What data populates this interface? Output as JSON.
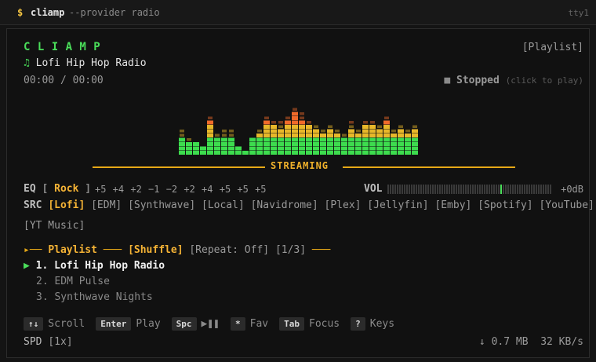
{
  "terminal": {
    "prompt": "$",
    "command": "cliamp",
    "args": "--provider radio",
    "tty": "tty1"
  },
  "player": {
    "logo": "C L I A M P",
    "playlist_toggle": "[Playlist]",
    "note_icon": "♫",
    "track_title": "Lofi Hip Hop Radio",
    "time": "00:00 / 00:00",
    "status_icon": "■",
    "status": "Stopped",
    "status_hint": "(click to play)"
  },
  "visualizer": {
    "label": "STREAMING",
    "colors": {
      "green": "#3ddc4e",
      "yellow": "#e8b82a",
      "orange": "#f06a2a"
    },
    "bands": [
      4,
      3,
      3,
      2,
      8,
      4,
      4,
      4,
      2,
      1,
      4,
      5,
      8,
      7,
      6,
      8,
      10,
      8,
      7,
      6,
      5,
      6,
      5,
      4,
      6,
      5,
      7,
      7,
      6,
      8,
      5,
      6,
      5,
      6
    ],
    "peaks": [
      6,
      4,
      3,
      2,
      9,
      5,
      6,
      6,
      2,
      1,
      4,
      6,
      9,
      8,
      8,
      9,
      11,
      10,
      8,
      7,
      6,
      7,
      6,
      5,
      8,
      6,
      8,
      8,
      7,
      9,
      6,
      7,
      6,
      7
    ]
  },
  "eq": {
    "label": "EQ",
    "bracket_open": "[",
    "preset": "Rock",
    "bracket_close": "]",
    "values": "+5 +4 +2 −1 −2 +2 +4 +5 +5 +5"
  },
  "volume": {
    "label": "VOL",
    "level": 0.7,
    "db": "+0dB"
  },
  "sources": {
    "label": "SRC",
    "active": "[Lofi]",
    "others": "[EDM] [Synthwave] [Local] [Navidrome] [Plex] [Jellyfin] [Emby] [Spotify] [YouTube]",
    "wrapped": "[YT Music]"
  },
  "playlist": {
    "prefix": "▸──",
    "title": "Playlist",
    "dash1": "───",
    "shuffle": "[Shuffle]",
    "repeat": "[Repeat: Off]",
    "position": "[1/3]",
    "dash2": "───",
    "play_icon": "▶",
    "items": [
      {
        "label": "1. Lofi Hip Hop Radio"
      },
      {
        "label": "2. EDM Pulse"
      },
      {
        "label": "3. Synthwave Nights"
      }
    ]
  },
  "keys": [
    {
      "key": "↑↓",
      "label": "Scroll"
    },
    {
      "key": "Enter",
      "label": "Play"
    },
    {
      "key": "Spc",
      "label": "▶❚❚"
    },
    {
      "key": "*",
      "label": "Fav"
    },
    {
      "key": "Tab",
      "label": "Focus"
    },
    {
      "key": "?",
      "label": "Keys"
    }
  ],
  "footer": {
    "spd_label": "SPD",
    "spd_value": "[1x]",
    "download": "↓ 0.7 MB",
    "rate": "32 KB/s"
  }
}
